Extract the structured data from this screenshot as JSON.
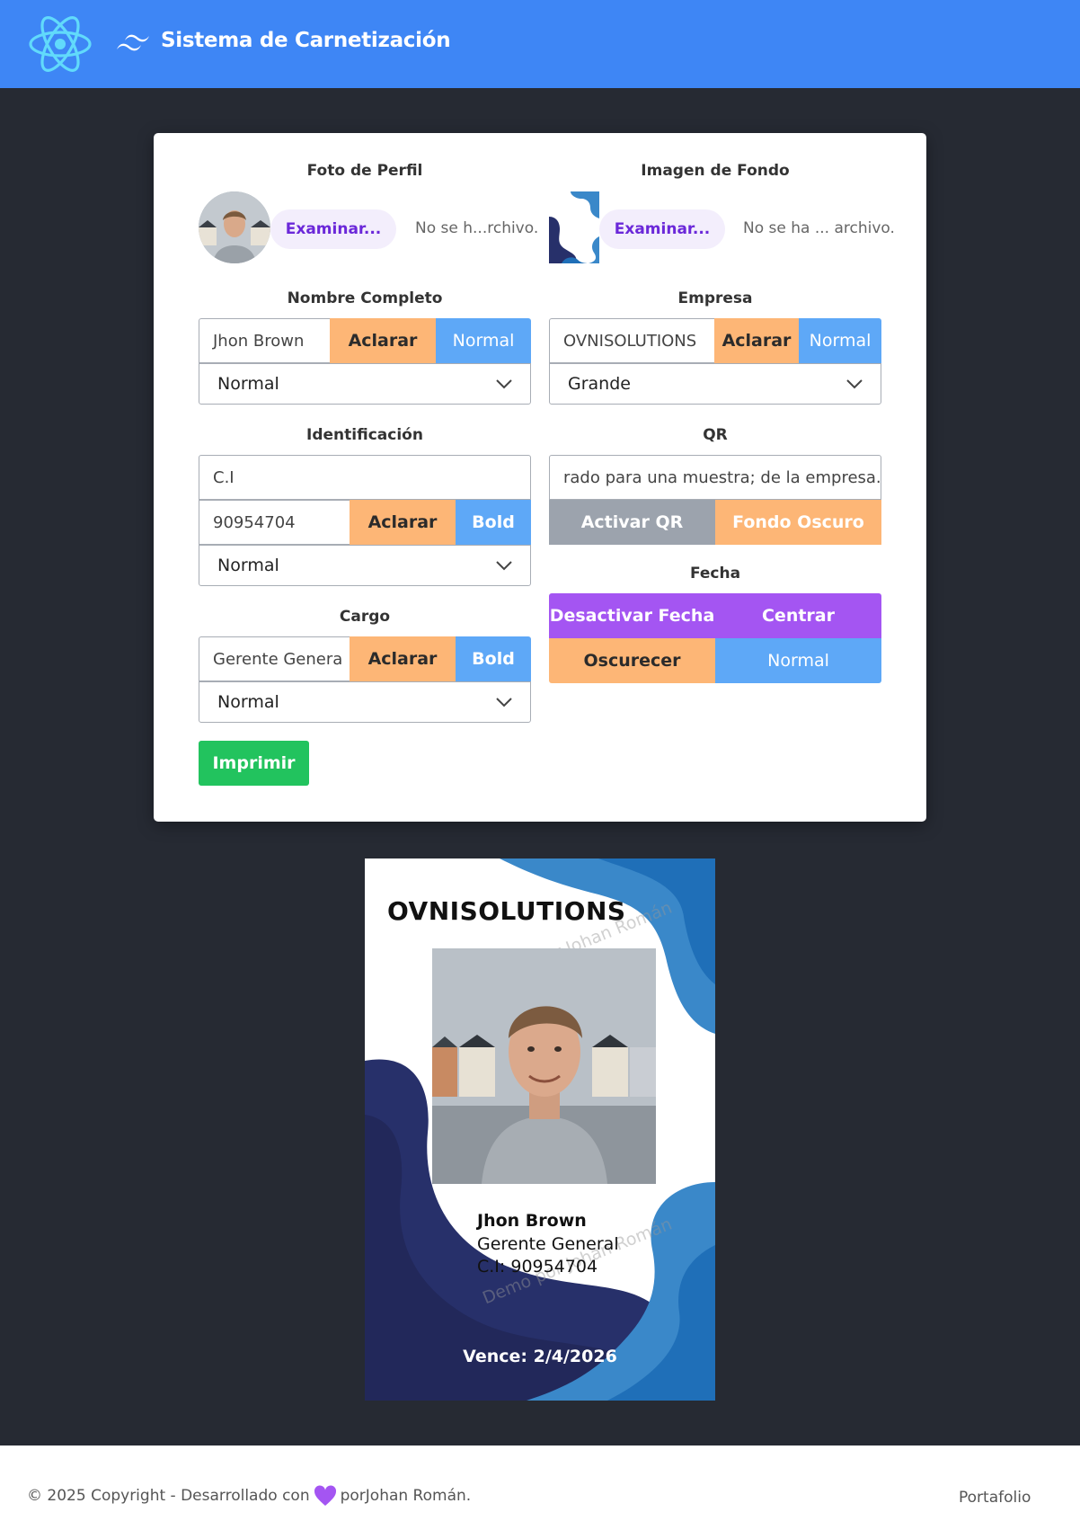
{
  "header": {
    "title": "Sistema de Carnetización"
  },
  "form": {
    "photo": {
      "label": "Foto de Perfil",
      "button": "Examinar...",
      "file_status": "No se h...rchivo."
    },
    "background": {
      "label": "Imagen de Fondo",
      "button": "Examinar...",
      "file_status": "No se ha ... archivo."
    },
    "name": {
      "label": "Nombre Completo",
      "value": "Jhon Brown",
      "clear": "Aclarar",
      "weight": "Normal",
      "size": "Normal"
    },
    "company": {
      "label": "Empresa",
      "value": "OVNISOLUTIONS",
      "clear": "Aclarar",
      "weight": "Normal",
      "size": "Grande"
    },
    "identification": {
      "label": "Identificación",
      "prefix": "C.I",
      "value": "90954704",
      "clear": "Aclarar",
      "weight": "Bold",
      "size": "Normal"
    },
    "qr": {
      "label": "QR",
      "value": "rado para una muestra; de la empresa.",
      "toggle": "Activar QR",
      "dark_bg": "Fondo Oscuro"
    },
    "position": {
      "label": "Cargo",
      "value": "Gerente Genera",
      "clear": "Aclarar",
      "weight": "Bold",
      "size": "Normal"
    },
    "date": {
      "label": "Fecha",
      "toggle": "Desactivar Fecha",
      "center": "Centrar",
      "darken": "Oscurecer",
      "weight": "Normal"
    },
    "print": "Imprimir"
  },
  "card": {
    "company": "OVNISOLUTIONS",
    "watermark": "Demo por Johan Román",
    "name": "Jhon Brown",
    "position": "Gerente General",
    "id": "C.I: 90954704",
    "expiry": "Vence: 2/4/2026"
  },
  "footer": {
    "copyright_prefix": "© 2025 Copyright - Desarrollado con",
    "copyright_suffix": "porJohan Román.",
    "portfolio": "Portafolio"
  },
  "colors": {
    "header": "#3e86f5",
    "page_bg": "#262a33",
    "orange": "#fdb676",
    "blue": "#5ea8f7",
    "purple": "#a455f2",
    "green": "#22c35e",
    "card_navy": "#27306a",
    "card_blue": "#3a88c9"
  }
}
